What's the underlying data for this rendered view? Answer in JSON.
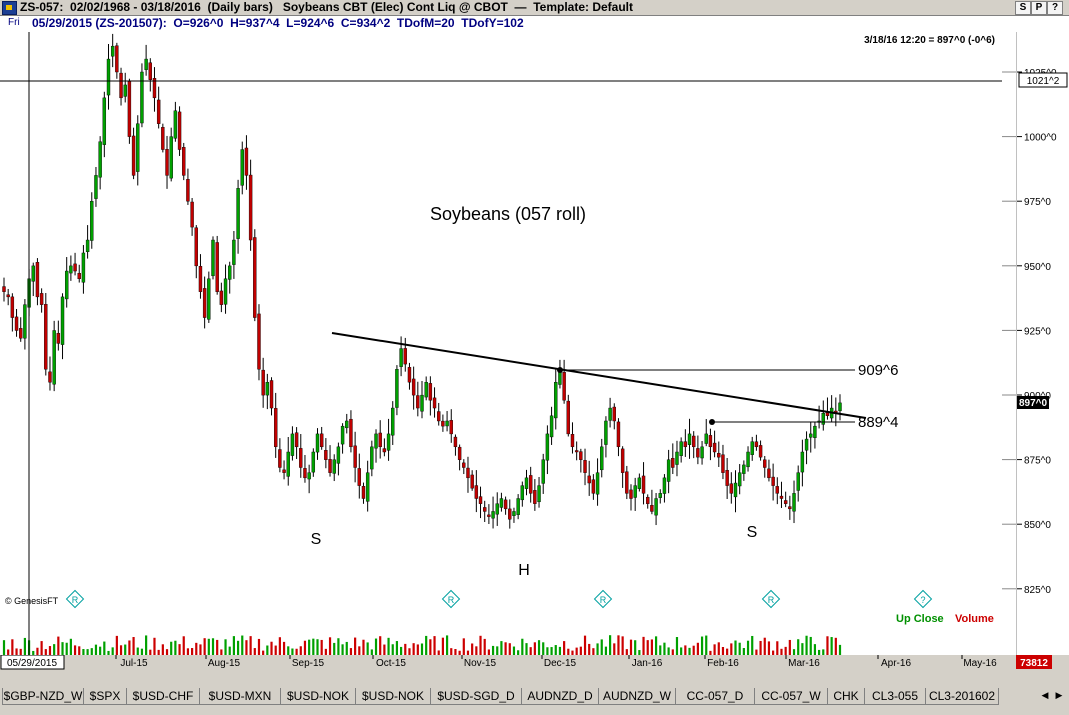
{
  "title_bar": {
    "text": "ZS-057:  02/02/1968 - 03/18/2016  (Daily bars)   Soybeans CBT (Elec) Cont Liq @ CBOT  —  Template: Default",
    "buttons": [
      "S",
      "P",
      "?"
    ]
  },
  "info_bar": {
    "day": "Fri",
    "text": "05/29/2015 (ZS-201507):  O=926^0  H=937^4  L=924^6  C=934^2  TDofM=20  TDofY=102"
  },
  "chart": {
    "last_quote": "3/18/16 12:20 = 897^0 (-0^6)",
    "title": "Soybeans (057 roll)",
    "pattern_labels": {
      "left_shoulder": "S",
      "head": "H",
      "right_shoulder": "S"
    },
    "level_labels": {
      "high": "909^6",
      "low": "889^4"
    },
    "watermark": "© GenesisFT",
    "up_close_label": "Up Close",
    "volume_label": "Volume",
    "crosshair_price": "1021^2",
    "last_price_box": "897^0",
    "volume_box": "73812",
    "cursor_date": "05/29/2015",
    "r_markers": [
      "R",
      "R",
      "R",
      "R"
    ],
    "q_marker": "?"
  },
  "chart_data": {
    "type": "candlestick",
    "title": "Soybeans (057 roll)",
    "y_ticks": [
      "1025^0",
      "1000^0",
      "975^0",
      "950^0",
      "925^0",
      "900^0",
      "875^0",
      "850^0",
      "825^0"
    ],
    "ylim": [
      815,
      1040
    ],
    "x_ticks": [
      "Jul-15",
      "Aug-15",
      "Sep-15",
      "Oct-15",
      "Nov-15",
      "Dec-15",
      "Jan-16",
      "Feb-16",
      "Mar-16",
      "Apr-16",
      "May-16"
    ],
    "neckline": {
      "from": {
        "date": "Sep-15",
        "price": 924
      },
      "to": {
        "date": "Mar-16",
        "price": 891
      }
    },
    "horizontal_levels": [
      909.75,
      889.5,
      1021.25
    ],
    "close_path": [
      940,
      938,
      930,
      925,
      922,
      935,
      945,
      950,
      938,
      935,
      910,
      905,
      925,
      920,
      938,
      948,
      950,
      948,
      945,
      955,
      960,
      975,
      985,
      998,
      1015,
      1030,
      1035,
      1025,
      1015,
      1020,
      1000,
      985,
      1005,
      1025,
      1030,
      1022,
      1015,
      1005,
      995,
      985,
      1000,
      1010,
      995,
      985,
      975,
      965,
      950,
      940,
      930,
      945,
      960,
      940,
      935,
      945,
      950,
      960,
      980,
      995,
      985,
      960,
      930,
      910,
      900,
      905,
      895,
      880,
      872,
      870,
      878,
      885,
      880,
      872,
      868,
      870,
      878,
      885,
      880,
      875,
      870,
      875,
      880,
      888,
      890,
      880,
      872,
      865,
      860,
      870,
      880,
      885,
      880,
      878,
      885,
      895,
      910,
      918,
      912,
      905,
      900,
      895,
      900,
      905,
      898,
      895,
      890,
      888,
      890,
      885,
      880,
      875,
      872,
      868,
      864,
      860,
      858,
      855,
      853,
      855,
      858,
      860,
      856,
      852,
      855,
      860,
      865,
      868,
      862,
      858,
      865,
      875,
      885,
      892,
      905,
      909,
      898,
      885,
      880,
      878,
      875,
      870,
      866,
      862,
      870,
      880,
      890,
      895,
      890,
      880,
      870,
      862,
      860,
      865,
      868,
      862,
      858,
      855,
      860,
      862,
      868,
      875,
      872,
      878,
      882,
      880,
      885,
      880,
      876,
      880,
      885,
      880,
      878,
      876,
      870,
      865,
      862,
      866,
      870,
      873,
      878,
      882,
      880,
      876,
      872,
      868,
      865,
      862,
      860,
      858,
      856,
      862,
      870,
      878,
      883,
      885,
      888,
      890,
      893,
      892,
      895,
      893,
      897
    ]
  },
  "tabs": [
    "$GBP-NZD_W",
    "$SPX",
    "$USD-CHF",
    "$USD-MXN",
    "$USD-NOK",
    "$USD-NOK",
    "$USD-SGD_D",
    "AUDNZD_D",
    "AUDNZD_W",
    "CC-057_D",
    "CC-057_W",
    "CHK",
    "CL3-055",
    "CL3-201602"
  ],
  "colors": {
    "up_candle": "#00a000",
    "down_candle": "#c00000",
    "up_close_text": "#009000",
    "volume_text": "#cc0000",
    "marker": "#00a0a0",
    "info_text": "#000080"
  }
}
